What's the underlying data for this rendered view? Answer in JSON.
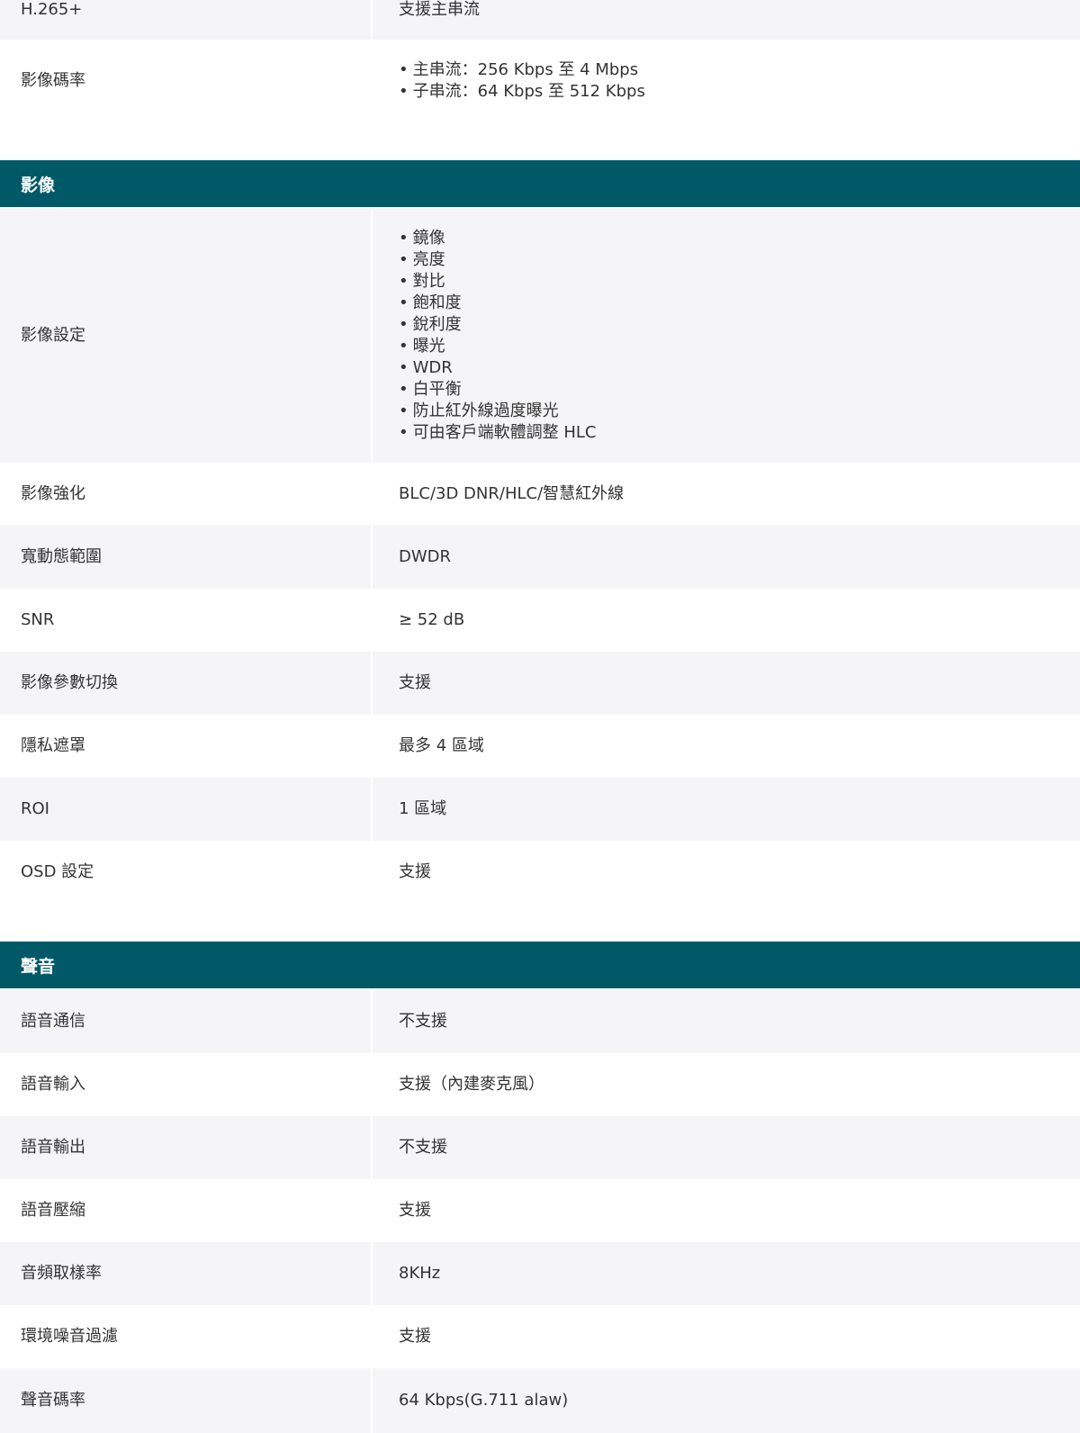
{
  "video": {
    "h265_label": "H.265+",
    "h265_value": "支援主串流",
    "bitrate_label": "影像碼率",
    "bitrate_values": [
      "主串流：256 Kbps 至 4 Mbps",
      "子串流：64 Kbps 至 512 Kbps"
    ]
  },
  "image": {
    "title": "影像",
    "rows": [
      {
        "label": "影像設定",
        "items": [
          "鏡像",
          "亮度",
          "對比",
          "飽和度",
          "銳利度",
          "曝光",
          "WDR",
          "白平衡",
          "防止紅外線過度曝光",
          "可由客戶端軟體調整 HLC"
        ]
      },
      {
        "label": "影像強化",
        "value": "BLC/3D DNR/HLC/智慧紅外線"
      },
      {
        "label": "寬動態範圍",
        "value": "DWDR"
      },
      {
        "label": "SNR",
        "value": "≥ 52 dB"
      },
      {
        "label": "影像參數切換",
        "value": "支援"
      },
      {
        "label": "隱私遮罩",
        "value": "最多 4 區域"
      },
      {
        "label": "ROI",
        "value": "1 區域"
      },
      {
        "label": "OSD 設定",
        "value": "支援"
      }
    ]
  },
  "audio": {
    "title": "聲音",
    "rows": [
      {
        "label": "語音通信",
        "value": "不支援"
      },
      {
        "label": "語音輸入",
        "value": "支援（內建麥克風）"
      },
      {
        "label": "語音輸出",
        "value": "不支援"
      },
      {
        "label": "語音壓縮",
        "value": "支援"
      },
      {
        "label": "音頻取樣率",
        "value": "8KHz"
      },
      {
        "label": "環境噪音過濾",
        "value": "支援"
      },
      {
        "label": "聲音碼率",
        "value": "64 Kbps(G.711 alaw)"
      }
    ]
  },
  "colors": {
    "header_bg": "#015968",
    "alt_row_bg": "#f5f5f7",
    "text": "#333333"
  }
}
